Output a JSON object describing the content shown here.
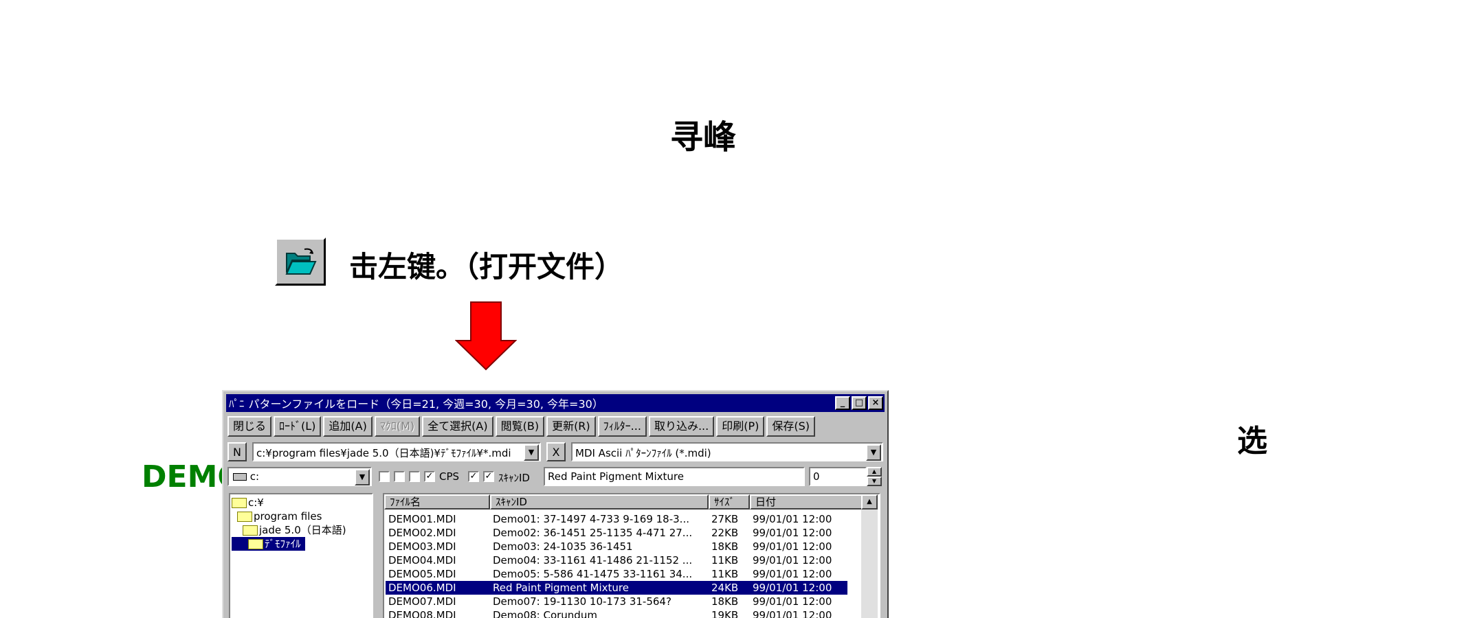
{
  "page": {
    "title": "寻峰",
    "instruction": "击左键。（打开文件）",
    "side_char": "选",
    "demo_label": "DEMO"
  },
  "colors": {
    "arrow": "#ff0000",
    "demo_label": "#008000",
    "titlebar": "#000080"
  },
  "window": {
    "app_glyph": "ﾊﾟﾆ",
    "title": "パターンファイルをロード（今日=21, 今週=30, 今月=30, 今年=30）",
    "controls": [
      "_",
      "□",
      "×"
    ],
    "toolbar": [
      {
        "label": "閉じる",
        "enabled": true
      },
      {
        "label": "ﾛｰﾄﾞ(L)",
        "enabled": true
      },
      {
        "label": "追加(A)",
        "enabled": true
      },
      {
        "label": "ﾏｸﾛ(M)",
        "enabled": false
      },
      {
        "label": "全て選択(A)",
        "enabled": true
      },
      {
        "label": "閲覧(B)",
        "enabled": true
      },
      {
        "label": "更新(R)",
        "enabled": true
      },
      {
        "label": "ﾌｨﾙﾀｰ...",
        "enabled": true
      },
      {
        "label": "取り込み...",
        "enabled": true
      },
      {
        "label": "印刷(P)",
        "enabled": true
      },
      {
        "label": "保存(S)",
        "enabled": true
      }
    ],
    "n_button": "N",
    "path": "c:¥program files¥jade 5.0（日本語)¥ﾃﾞﾓﾌｧｲﾙ¥*.mdi",
    "clear_button": "X",
    "filetype": "MDI Ascii ﾊﾟﾀｰﾝﾌｧｲﾙ (*.mdi)",
    "drive": "c:",
    "cps_label": "CPS",
    "scan_label": "ｽｷｬﾝID",
    "scan_value": "Red Paint Pigment Mixture",
    "number_value": "0",
    "check_marks": [
      "",
      "",
      "",
      "✓",
      "✓",
      "✓"
    ],
    "tree": [
      "c:¥",
      "program files",
      "jade 5.0（日本語)",
      "ﾃﾞﾓﾌｧｲﾙ"
    ],
    "columns": [
      "ﾌｧｲﾙ名",
      "ｽｷｬﾝID",
      "ｻｲｽﾞ",
      "日付"
    ],
    "files": [
      {
        "name": "DEMO01.MDI",
        "scan": "Demo01: 37-1497 4-733 9-169 18-3...",
        "size": "27KB",
        "date": "99/01/01 12:00"
      },
      {
        "name": "DEMO02.MDI",
        "scan": "Demo02: 36-1451 25-1135 4-471 27...",
        "size": "22KB",
        "date": "99/01/01 12:00"
      },
      {
        "name": "DEMO03.MDI",
        "scan": "Demo03: 24-1035 36-1451",
        "size": "18KB",
        "date": "99/01/01 12:00"
      },
      {
        "name": "DEMO04.MDI",
        "scan": "Demo04: 33-1161 41-1486 21-1152 ...",
        "size": "11KB",
        "date": "99/01/01 12:00"
      },
      {
        "name": "DEMO05.MDI",
        "scan": "Demo05: 5-586 41-1475 33-1161 34...",
        "size": "11KB",
        "date": "99/01/01 12:00"
      },
      {
        "name": "DEMO06.MDI",
        "scan": "Red Paint Pigment Mixture",
        "size": "24KB",
        "date": "99/01/01 12:00"
      },
      {
        "name": "DEMO07.MDI",
        "scan": "Demo07: 19-1130 10-173 31-564?",
        "size": "18KB",
        "date": "99/01/01 12:00"
      },
      {
        "name": "DEMO08.MDI",
        "scan": "Demo08: Corundum",
        "size": "19KB",
        "date": "99/01/01 12:00"
      }
    ],
    "selected_file": 5
  }
}
